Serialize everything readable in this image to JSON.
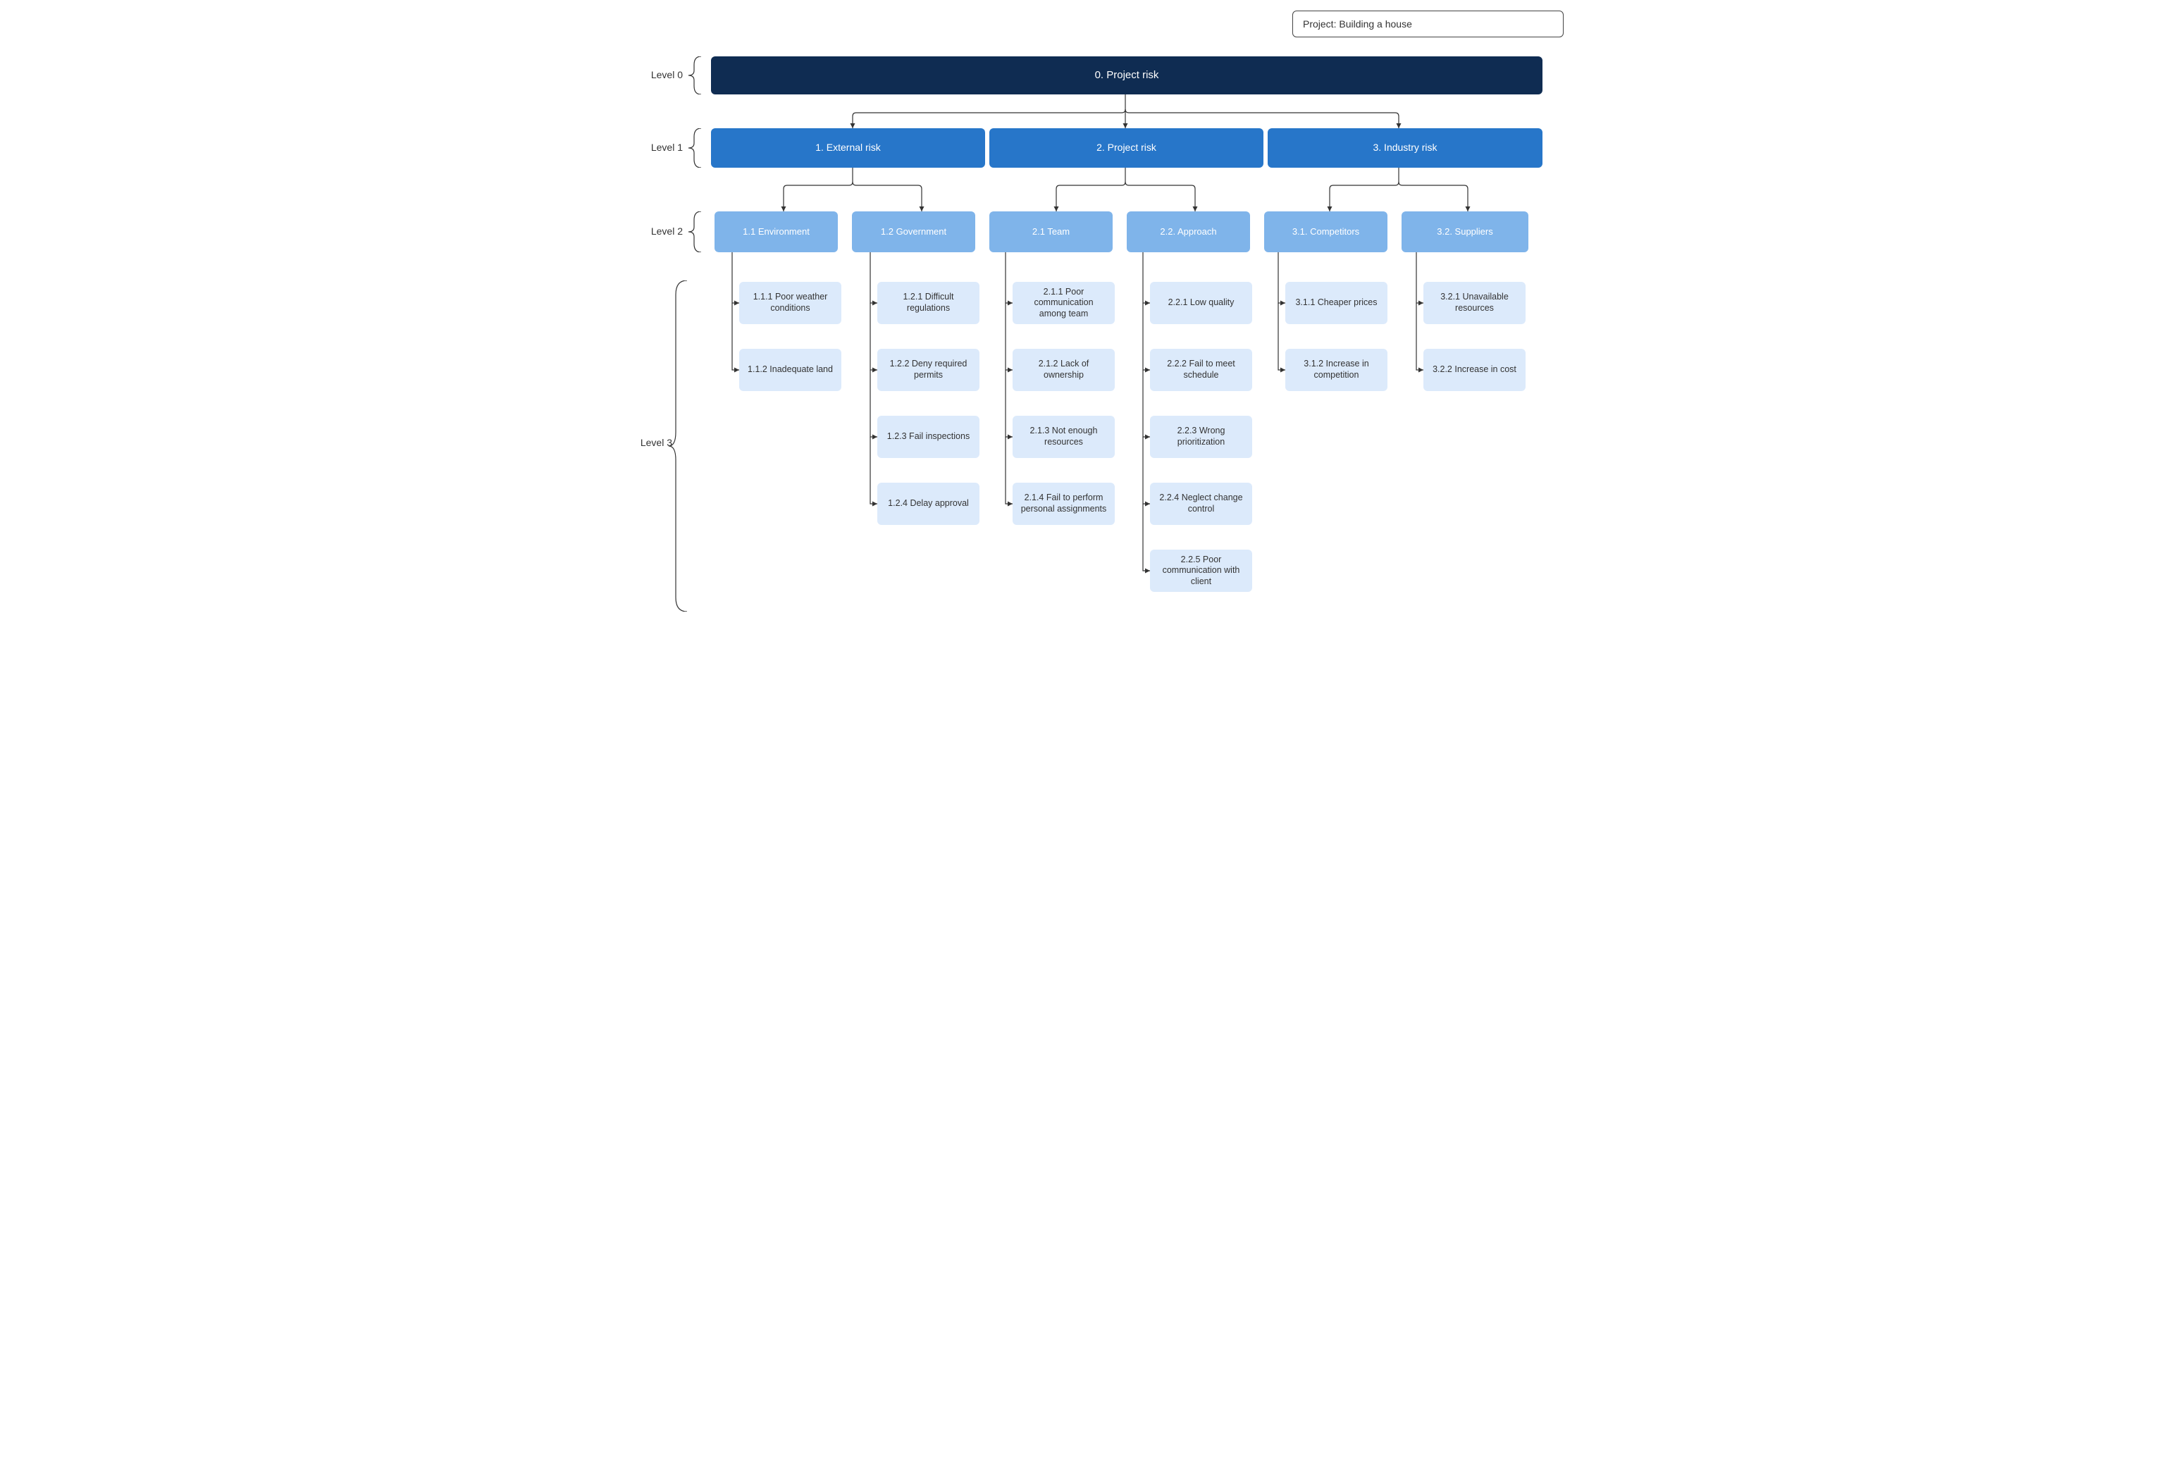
{
  "project_box": "Project: Building a house",
  "levels": {
    "l0": "Level 0",
    "l1": "Level 1",
    "l2": "Level 2",
    "l3": "Level 3"
  },
  "root": "0. Project risk",
  "l1": {
    "external": "1. External risk",
    "project": "2. Project risk",
    "industry": "3. Industry risk"
  },
  "l2": {
    "environment": "1.1 Environment",
    "government": "1.2 Government",
    "team": "2.1 Team",
    "approach": "2.2. Approach",
    "competitors": "3.1. Competitors",
    "suppliers": "3.2. Suppliers"
  },
  "l3": {
    "env": {
      "weather": "1.1.1 Poor weather conditions",
      "land": "1.1.2 Inadequate land"
    },
    "gov": {
      "regs": "1.2.1 Difficult regulations",
      "permits": "1.2.2 Deny required permits",
      "inspections": "1.2.3 Fail inspections",
      "approval": "1.2.4 Delay approval"
    },
    "team": {
      "comm": "2.1.1 Poor communication among team",
      "ownership": "2.1.2 Lack of ownership",
      "resources": "2.1.3 Not enough resources",
      "assignments": "2.1.4 Fail to perform personal assignments"
    },
    "approach": {
      "quality": "2.2.1 Low quality",
      "schedule": "2.2.2 Fail to meet schedule",
      "priority": "2.2.3 Wrong prioritization",
      "change": "2.2.4 Neglect change control",
      "client": "2.2.5 Poor communication with client"
    },
    "comp": {
      "prices": "3.1.1 Cheaper prices",
      "competition": "3.1.2 Increase in competition"
    },
    "supp": {
      "unavailable": "3.2.1 Unavailable resources",
      "cost": "3.2.2 Increase in cost"
    }
  },
  "chart_data": {
    "type": "tree",
    "title": "Project: Building a house",
    "root": {
      "id": "0",
      "label": "Project risk",
      "level": 0,
      "children": [
        {
          "id": "1",
          "label": "External risk",
          "level": 1,
          "children": [
            {
              "id": "1.1",
              "label": "Environment",
              "level": 2,
              "children": [
                {
                  "id": "1.1.1",
                  "label": "Poor weather conditions",
                  "level": 3
                },
                {
                  "id": "1.1.2",
                  "label": "Inadequate land",
                  "level": 3
                }
              ]
            },
            {
              "id": "1.2",
              "label": "Government",
              "level": 2,
              "children": [
                {
                  "id": "1.2.1",
                  "label": "Difficult regulations",
                  "level": 3
                },
                {
                  "id": "1.2.2",
                  "label": "Deny required permits",
                  "level": 3
                },
                {
                  "id": "1.2.3",
                  "label": "Fail inspections",
                  "level": 3
                },
                {
                  "id": "1.2.4",
                  "label": "Delay approval",
                  "level": 3
                }
              ]
            }
          ]
        },
        {
          "id": "2",
          "label": "Project risk",
          "level": 1,
          "children": [
            {
              "id": "2.1",
              "label": "Team",
              "level": 2,
              "children": [
                {
                  "id": "2.1.1",
                  "label": "Poor communication among team",
                  "level": 3
                },
                {
                  "id": "2.1.2",
                  "label": "Lack of ownership",
                  "level": 3
                },
                {
                  "id": "2.1.3",
                  "label": "Not enough resources",
                  "level": 3
                },
                {
                  "id": "2.1.4",
                  "label": "Fail to perform personal assignments",
                  "level": 3
                }
              ]
            },
            {
              "id": "2.2",
              "label": "Approach",
              "level": 2,
              "children": [
                {
                  "id": "2.2.1",
                  "label": "Low quality",
                  "level": 3
                },
                {
                  "id": "2.2.2",
                  "label": "Fail to meet schedule",
                  "level": 3
                },
                {
                  "id": "2.2.3",
                  "label": "Wrong prioritization",
                  "level": 3
                },
                {
                  "id": "2.2.4",
                  "label": "Neglect change control",
                  "level": 3
                },
                {
                  "id": "2.2.5",
                  "label": "Poor communication with client",
                  "level": 3
                }
              ]
            }
          ]
        },
        {
          "id": "3",
          "label": "Industry risk",
          "level": 1,
          "children": [
            {
              "id": "3.1",
              "label": "Competitors",
              "level": 2,
              "children": [
                {
                  "id": "3.1.1",
                  "label": "Cheaper prices",
                  "level": 3
                },
                {
                  "id": "3.1.2",
                  "label": "Increase in competition",
                  "level": 3
                }
              ]
            },
            {
              "id": "3.2",
              "label": "Suppliers",
              "level": 2,
              "children": [
                {
                  "id": "3.2.1",
                  "label": "Unavailable resources",
                  "level": 3
                },
                {
                  "id": "3.2.2",
                  "label": "Increase in cost",
                  "level": 3
                }
              ]
            }
          ]
        }
      ]
    }
  }
}
